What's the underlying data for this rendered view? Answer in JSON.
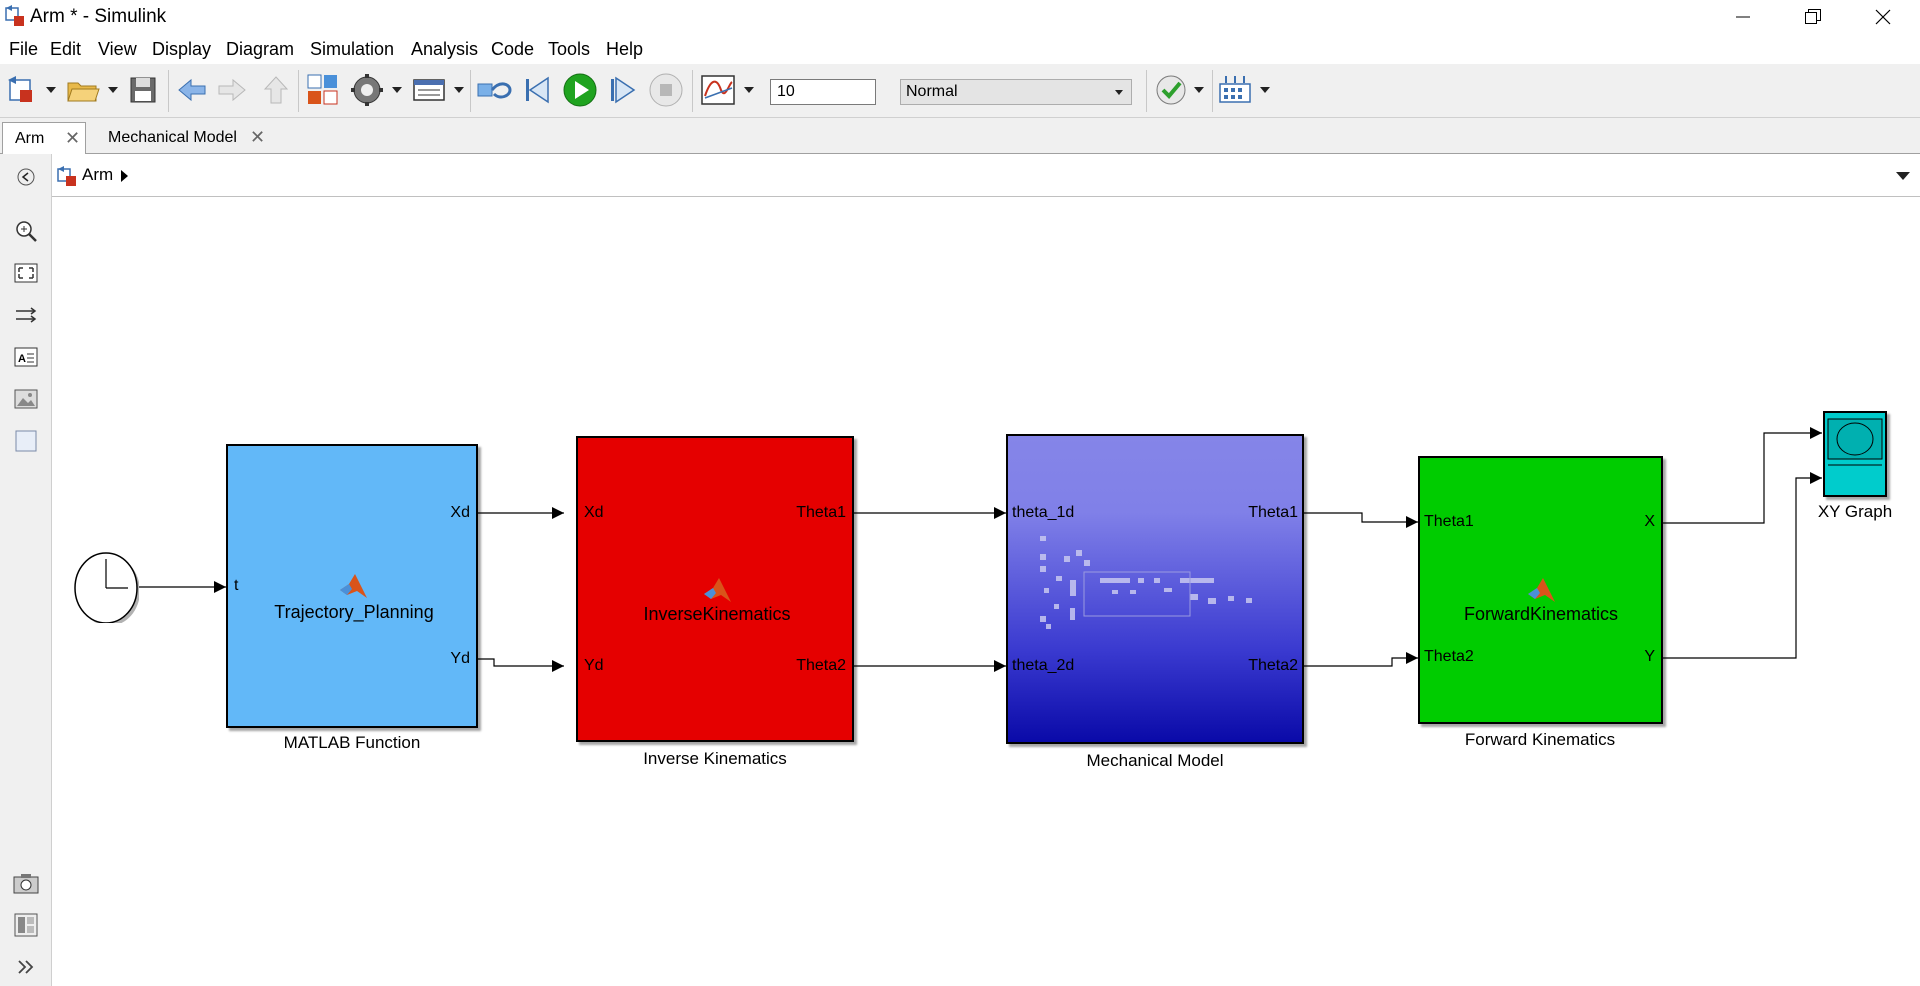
{
  "window": {
    "title": "Arm * - Simulink",
    "controls": [
      "minimize",
      "restore",
      "close"
    ]
  },
  "menu": [
    "File",
    "Edit",
    "View",
    "Display",
    "Diagram",
    "Simulation",
    "Analysis",
    "Code",
    "Tools",
    "Help"
  ],
  "toolbar": {
    "stop_time": "10",
    "sim_mode": "Normal",
    "icons": [
      "new-model-icon",
      "open-icon",
      "save-icon",
      "back-icon",
      "forward-icon",
      "up-icon",
      "library-browser-icon",
      "model-config-icon",
      "model-explorer-icon",
      "update-diagram-icon",
      "step-back-icon",
      "run-icon",
      "step-forward-icon",
      "stop-icon",
      "data-inspector-icon",
      "model-advisor-icon",
      "build-icon"
    ]
  },
  "tabs": [
    {
      "label": "Arm",
      "active": true
    },
    {
      "label": "Mechanical Model",
      "active": false
    }
  ],
  "breadcrumb": {
    "label": "Arm"
  },
  "palette": [
    "back-icon",
    "zoom-icon",
    "fit-view-icon",
    "arrange-icon",
    "annotation-icon",
    "image-icon",
    "area-icon",
    "screenshot-icon",
    "model-browser-icon",
    "expand-icon"
  ],
  "blocks": {
    "clock": {
      "name": "Clock"
    },
    "matlab_fn": {
      "name": "MATLAB Function",
      "function": "Trajectory_Planning",
      "in_ports": [
        "t"
      ],
      "out_ports": [
        "Xd",
        "Yd"
      ],
      "color": "#62b8f8"
    },
    "inverse": {
      "name": "Inverse Kinematics",
      "function": "InverseKinematics",
      "in_ports": [
        "Xd",
        "Yd"
      ],
      "out_ports": [
        "Theta1",
        "Theta2"
      ],
      "color": "#e50000"
    },
    "mechanical": {
      "name": "Mechanical Model",
      "in_ports": [
        "theta_1d",
        "theta_2d"
      ],
      "out_ports": [
        "Theta1",
        "Theta2"
      ],
      "color_top": "#8585e8",
      "color_bottom": "#0a0aa8"
    },
    "forward": {
      "name": "Forward Kinematics",
      "function": "ForwardKinematics",
      "in_ports": [
        "Theta1",
        "Theta2"
      ],
      "out_ports": [
        "X",
        "Y"
      ],
      "color": "#00cc00"
    },
    "xy_graph": {
      "name": "XY Graph",
      "color": "#00cccc"
    }
  }
}
